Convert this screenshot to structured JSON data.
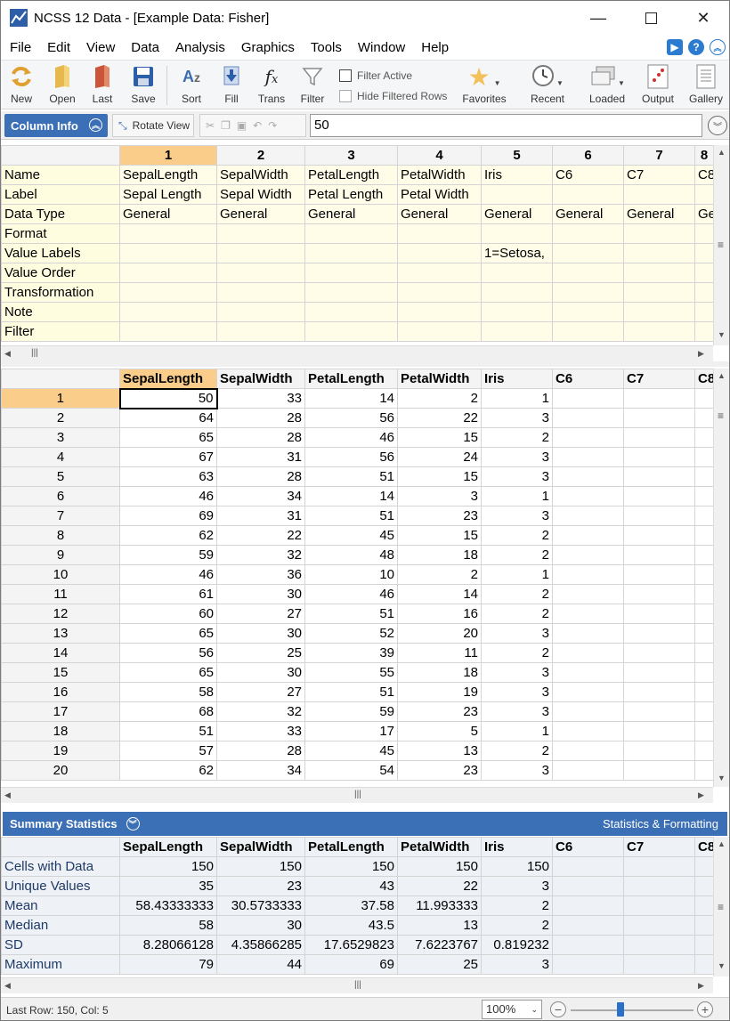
{
  "window": {
    "title": "NCSS 12 Data - [Example Data: Fisher]"
  },
  "menu": [
    "File",
    "Edit",
    "View",
    "Data",
    "Analysis",
    "Graphics",
    "Tools",
    "Window",
    "Help"
  ],
  "toolbar": {
    "new": "New",
    "open": "Open",
    "last": "Last",
    "save": "Save",
    "sort": "Sort",
    "fill": "Fill",
    "trans": "Trans",
    "filter": "Filter",
    "filter_active": "Filter Active",
    "hide_filtered": "Hide Filtered Rows",
    "favorites": "Favorites",
    "recent": "Recent",
    "loaded": "Loaded",
    "output": "Output",
    "gallery": "Gallery"
  },
  "editbar": {
    "column_info": "Column Info",
    "rotate_view": "Rotate View",
    "cell_value": "50"
  },
  "column_info": {
    "col_numbers": [
      "1",
      "2",
      "3",
      "4",
      "5",
      "6",
      "7",
      "8"
    ],
    "row_labels": [
      "Name",
      "Label",
      "Data Type",
      "Format",
      "Value Labels",
      "Value Order",
      "Transformation",
      "Note",
      "Filter"
    ],
    "rows": [
      [
        "SepalLength",
        "SepalWidth",
        "PetalLength",
        "PetalWidth",
        "Iris",
        "C6",
        "C7",
        "C8"
      ],
      [
        "Sepal Length",
        "Sepal Width",
        "Petal Length",
        "Petal Width",
        "",
        "",
        "",
        ""
      ],
      [
        "General",
        "General",
        "General",
        "General",
        "General",
        "General",
        "General",
        "General"
      ],
      [
        "",
        "",
        "",
        "",
        "",
        "",
        "",
        ""
      ],
      [
        "",
        "",
        "",
        "",
        "1=Setosa,",
        "",
        "",
        ""
      ],
      [
        "",
        "",
        "",
        "",
        "",
        "",
        "",
        ""
      ],
      [
        "",
        "",
        "",
        "",
        "",
        "",
        "",
        ""
      ],
      [
        "",
        "",
        "",
        "",
        "",
        "",
        "",
        ""
      ],
      [
        "",
        "",
        "",
        "",
        "",
        "",
        "",
        ""
      ]
    ]
  },
  "sheet": {
    "columns": [
      "SepalLength",
      "SepalWidth",
      "PetalLength",
      "PetalWidth",
      "Iris",
      "C6",
      "C7",
      "C8"
    ],
    "rows": [
      [
        "1",
        "50",
        "33",
        "14",
        "2",
        "1"
      ],
      [
        "2",
        "64",
        "28",
        "56",
        "22",
        "3"
      ],
      [
        "3",
        "65",
        "28",
        "46",
        "15",
        "2"
      ],
      [
        "4",
        "67",
        "31",
        "56",
        "24",
        "3"
      ],
      [
        "5",
        "63",
        "28",
        "51",
        "15",
        "3"
      ],
      [
        "6",
        "46",
        "34",
        "14",
        "3",
        "1"
      ],
      [
        "7",
        "69",
        "31",
        "51",
        "23",
        "3"
      ],
      [
        "8",
        "62",
        "22",
        "45",
        "15",
        "2"
      ],
      [
        "9",
        "59",
        "32",
        "48",
        "18",
        "2"
      ],
      [
        "10",
        "46",
        "36",
        "10",
        "2",
        "1"
      ],
      [
        "11",
        "61",
        "30",
        "46",
        "14",
        "2"
      ],
      [
        "12",
        "60",
        "27",
        "51",
        "16",
        "2"
      ],
      [
        "13",
        "65",
        "30",
        "52",
        "20",
        "3"
      ],
      [
        "14",
        "56",
        "25",
        "39",
        "11",
        "2"
      ],
      [
        "15",
        "65",
        "30",
        "55",
        "18",
        "3"
      ],
      [
        "16",
        "58",
        "27",
        "51",
        "19",
        "3"
      ],
      [
        "17",
        "68",
        "32",
        "59",
        "23",
        "3"
      ],
      [
        "18",
        "51",
        "33",
        "17",
        "5",
        "1"
      ],
      [
        "19",
        "57",
        "28",
        "45",
        "13",
        "2"
      ],
      [
        "20",
        "62",
        "34",
        "54",
        "23",
        "3"
      ]
    ]
  },
  "summary": {
    "title": "Summary Statistics",
    "right_label": "Statistics & Formatting",
    "columns": [
      "SepalLength",
      "SepalWidth",
      "PetalLength",
      "PetalWidth",
      "Iris",
      "C6",
      "C7",
      "C8"
    ],
    "rows": [
      [
        "Cells with Data",
        "150",
        "150",
        "150",
        "150",
        "150"
      ],
      [
        "Unique Values",
        "35",
        "23",
        "43",
        "22",
        "3"
      ],
      [
        "Mean",
        "58.43333333",
        "30.5733333",
        "37.58",
        "11.993333",
        "2"
      ],
      [
        "Median",
        "58",
        "30",
        "43.5",
        "13",
        "2"
      ],
      [
        "SD",
        "8.28066128",
        "4.35866285",
        "17.6529823",
        "7.6223767",
        "0.819232"
      ],
      [
        "Maximum",
        "79",
        "44",
        "69",
        "25",
        "3"
      ]
    ]
  },
  "status": {
    "text": "Last Row: 150, Col: 5",
    "zoom": "100%"
  }
}
